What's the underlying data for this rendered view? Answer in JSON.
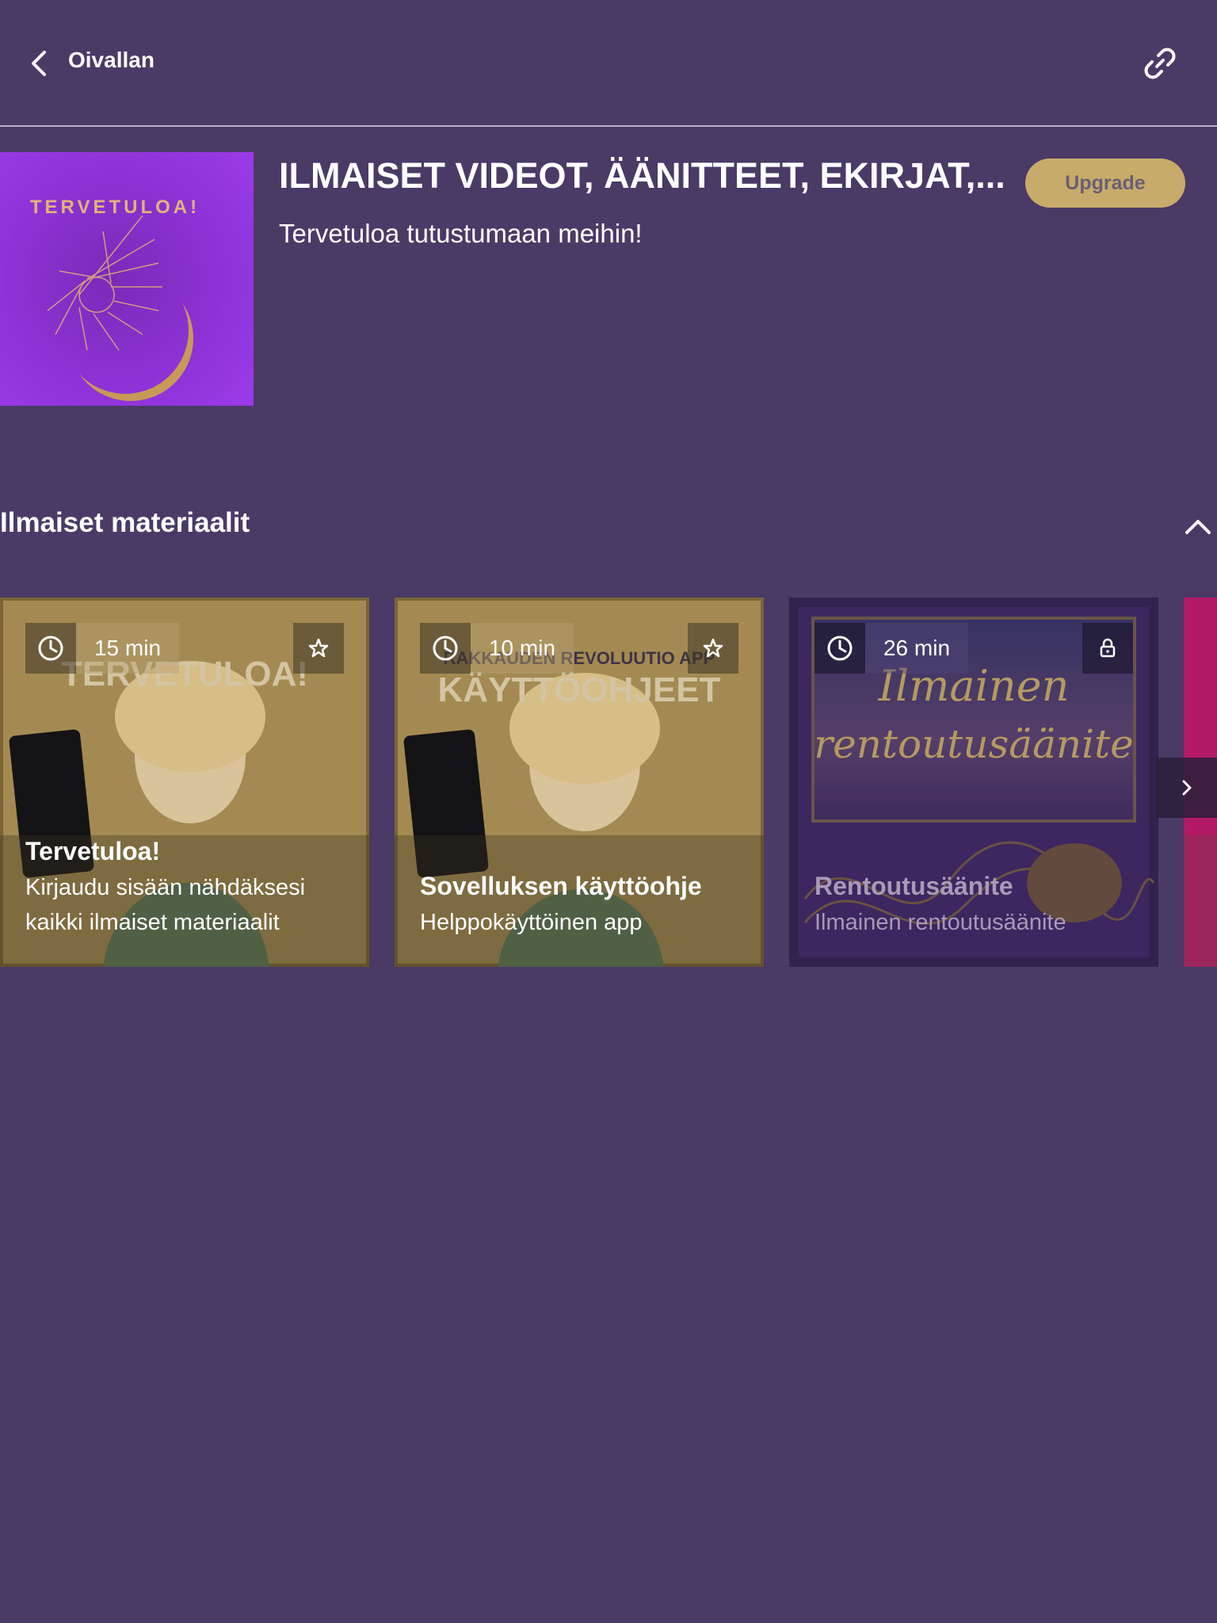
{
  "header": {
    "back_label": "Oivallan",
    "back_icon": "chevron-left-icon",
    "link_icon": "link-icon"
  },
  "hero": {
    "image_text": "TERVETULOA!",
    "title": "ILMAISET VIDEOT, ÄÄNITTEET, EKIRJAT,...",
    "subtitle": "Tervetuloa tutustumaan meihin!",
    "upgrade_label": "Upgrade"
  },
  "section": {
    "title": "Ilmaiset materiaalit"
  },
  "cards": [
    {
      "duration": "15 min",
      "action_icon": "star-icon",
      "bg_text": "TERVETULOA!",
      "title": "Tervetuloa!",
      "desc_line1": "Kirjaudu sisään nähdäksesi",
      "desc_line2": "kaikki ilmaiset materiaalit"
    },
    {
      "duration": "10 min",
      "action_icon": "star-icon",
      "bg_text_top": "RAKKAUDEN REVOLUUTIO APP",
      "bg_text": "KÄYTTÖOHJEET",
      "title": "Sovelluksen käyttöohje",
      "desc_line1": "Helppokäyttöinen app"
    },
    {
      "duration": "26 min",
      "action_icon": "lock-icon",
      "bg_text_line1": "Ilmainen",
      "bg_text_line2": "rentoutusäänite",
      "title": "Rentoutusäänite",
      "desc_line1": "Ilmainen rentoutusäänite"
    }
  ],
  "colors": {
    "background": "#4a3a66",
    "accent_gold": "#c8ab6a",
    "text": "#ffffff"
  }
}
